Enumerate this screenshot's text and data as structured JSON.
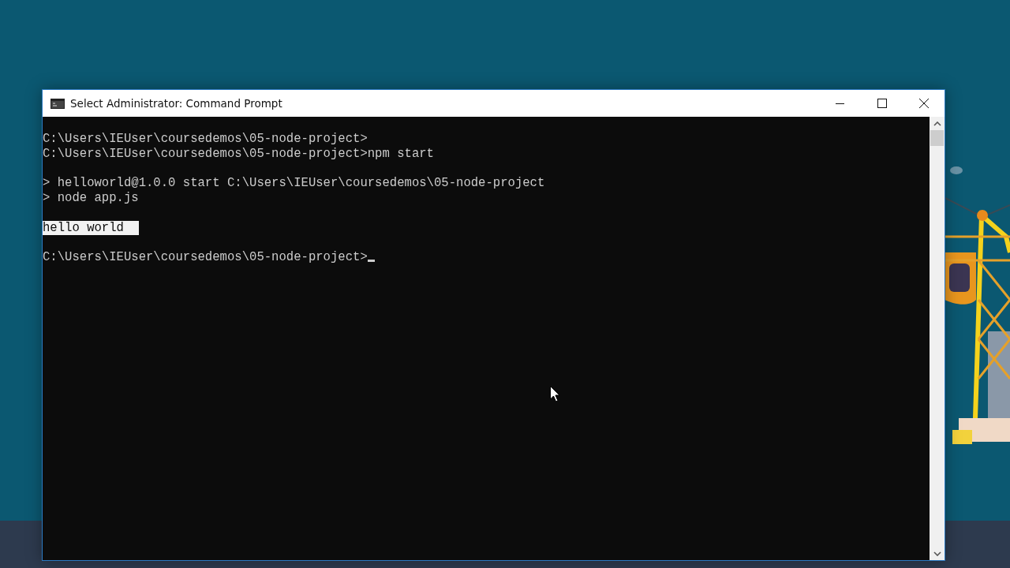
{
  "window": {
    "title": "Select Administrator: Command Prompt"
  },
  "console": {
    "lines": [
      {
        "kind": "blank"
      },
      {
        "kind": "text",
        "text": "C:\\Users\\IEUser\\coursedemos\\05-node-project>"
      },
      {
        "kind": "text",
        "text": "C:\\Users\\IEUser\\coursedemos\\05-node-project>npm start"
      },
      {
        "kind": "blank"
      },
      {
        "kind": "text",
        "text": "> helloworld@1.0.0 start C:\\Users\\IEUser\\coursedemos\\05-node-project"
      },
      {
        "kind": "text",
        "text": "> node app.js"
      },
      {
        "kind": "blank"
      },
      {
        "kind": "text",
        "text": "hello world",
        "selected": true
      },
      {
        "kind": "blank"
      },
      {
        "kind": "text",
        "text": "C:\\Users\\IEUser\\coursedemos\\05-node-project>",
        "cursor": true
      }
    ]
  }
}
